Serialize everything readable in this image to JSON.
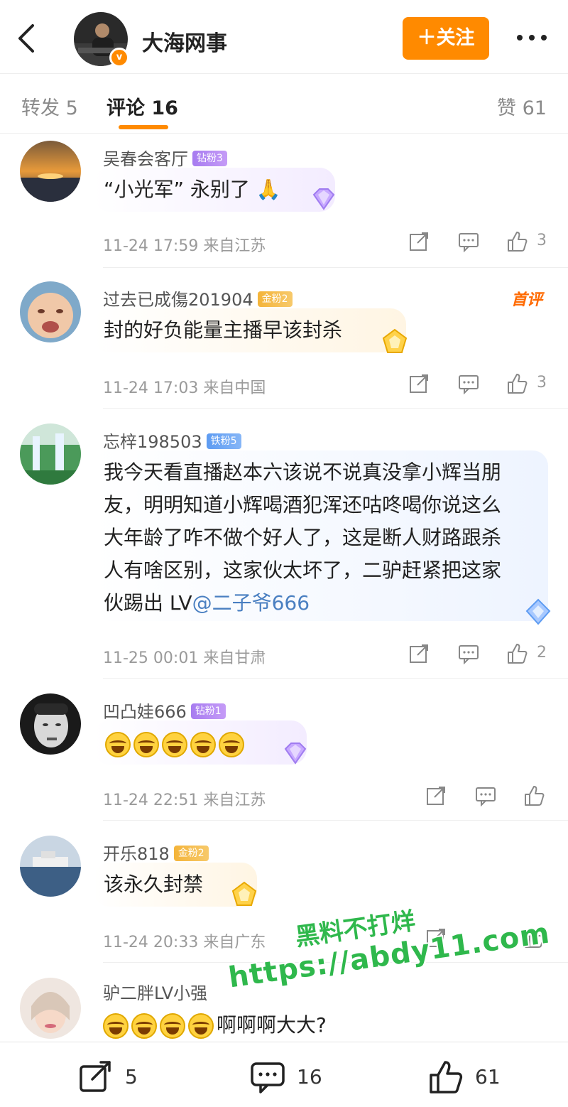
{
  "header": {
    "account_name": "大海网事",
    "follow_label": "＋关注",
    "verified_badge": "v",
    "icons": {
      "back": "back-arrow-icon",
      "more": "more-dots-icon"
    }
  },
  "tabs": {
    "repost": "转发 5",
    "comment": "评论 16",
    "like": "赞 61"
  },
  "comments": [
    {
      "name": "吴春会客厅",
      "badge": "钻粉3",
      "badge_color": "purple",
      "text": "“小光军” 永别了 🙏",
      "time": "11-24 17:59",
      "location": "来自江苏",
      "likes": "3",
      "first_tag": ""
    },
    {
      "name": "过去已成傷201904",
      "badge": "金粉2",
      "badge_color": "gold",
      "text": "封的好负能量主播早该封杀",
      "time": "11-24 17:03",
      "location": "来自中国",
      "likes": "3",
      "first_tag": "首评"
    },
    {
      "name": "忘梓198503",
      "badge": "铁粉5",
      "badge_color": "blue",
      "text_lines": [
        "我今天看直播赵本六该说不说真没拿小辉当朋",
        "友，明明知道小辉喝酒犯浑还咕咚喝你说这么",
        "大年龄了咋不做个好人了，这是断人财路跟杀",
        "人有啥区别，这家伙太坏了，二驴赶紧把这家",
        "伙踢出 LV"
      ],
      "mention": "@二子爷666",
      "time": "11-25 00:01",
      "location": "来自甘肃",
      "likes": "2"
    },
    {
      "name": "凹凸娃666",
      "badge": "钻粉1",
      "badge_color": "purple",
      "emoji_count": 5,
      "time": "11-24 22:51",
      "location": "来自江苏",
      "likes": ""
    },
    {
      "name": "开乐818",
      "badge": "金粉2",
      "badge_color": "gold",
      "text": "该永久封禁",
      "time": "11-24 20:33",
      "location": "来自广东",
      "likes": ""
    },
    {
      "name": "驴二胖LV小强",
      "text": "啊啊啊大大?",
      "emoji_count": 4
    }
  ],
  "watermark": {
    "line1": "黑料不打烊",
    "line2": "https://abdy11.com"
  },
  "bottom_bar": {
    "repost_count": "5",
    "comment_count": "16",
    "like_count": "61"
  },
  "colors": {
    "accent": "#ff8a00",
    "meta_gray": "#9a9a9a",
    "mention_blue": "#4a7fc1",
    "watermark_green": "#2fb84c"
  }
}
